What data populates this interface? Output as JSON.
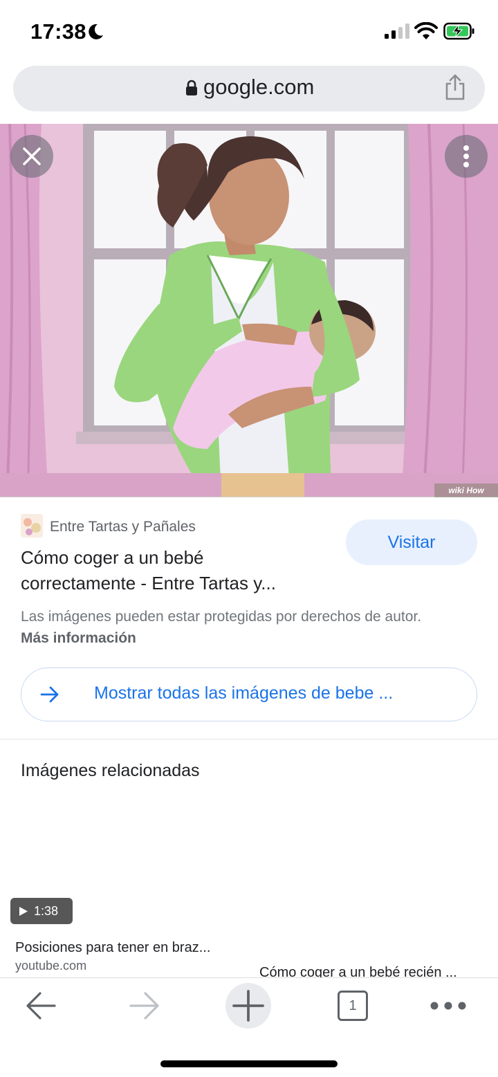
{
  "status_bar": {
    "time": "17:38",
    "icons": [
      "moon-icon",
      "signal-icon",
      "wifi-icon",
      "battery-charging-icon"
    ]
  },
  "browser": {
    "url": "google.com",
    "icons": [
      "lock-icon",
      "share-icon"
    ]
  },
  "viewer": {
    "close_icon": "close-icon",
    "more_icon": "more-vertical-icon",
    "watermark": "wiki How"
  },
  "result": {
    "source_name": "Entre Tartas y Pañales",
    "visit_label": "Visitar",
    "title_line1": "Cómo coger a un bebé",
    "title_line2": "correctamente - Entre Tartas y...",
    "copyright_text": "Las imágenes pueden estar protegidas por derechos de autor.",
    "more_info_link": "Más información",
    "show_all_label": "Mostrar todas las imágenes de bebe ..."
  },
  "related": {
    "heading": "Imágenes relacionadas",
    "items": [
      {
        "title": "Posiciones para tener en braz...",
        "source": "youtube.com",
        "duration": "1:38"
      },
      {
        "title": "Cómo coger a un bebé recién ..."
      }
    ]
  },
  "toolbar": {
    "tab_count": "1",
    "icons": [
      "back-arrow-icon",
      "forward-arrow-icon",
      "plus-icon",
      "tabs-icon",
      "more-horizontal-icon"
    ]
  },
  "colors": {
    "accent": "#1a73e8",
    "url_bar": "#e8eaed",
    "visit_bg": "#e8f0fe"
  }
}
